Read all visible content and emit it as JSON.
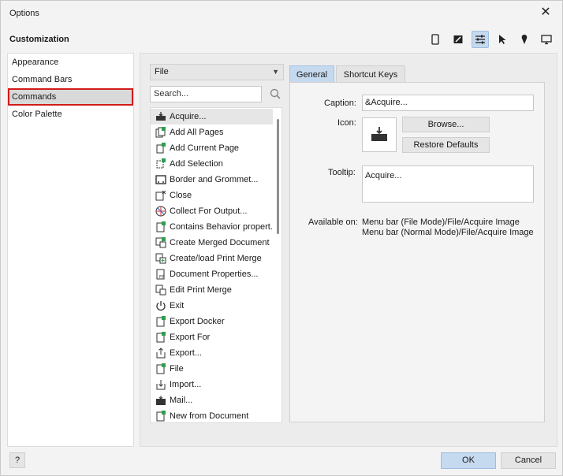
{
  "window": {
    "title": "Options"
  },
  "section_title": "Customization",
  "toolbar_icons": [
    {
      "name": "document-icon"
    },
    {
      "name": "image-edit-icon"
    },
    {
      "name": "sliders-icon",
      "active": true
    },
    {
      "name": "pointer-icon"
    },
    {
      "name": "pin-icon"
    },
    {
      "name": "monitor-icon"
    }
  ],
  "nav": [
    {
      "label": "Appearance"
    },
    {
      "label": "Command Bars"
    },
    {
      "label": "Commands",
      "selected": true
    },
    {
      "label": "Color Palette"
    }
  ],
  "category_select": {
    "value": "File"
  },
  "search": {
    "placeholder": "Search..."
  },
  "commands": [
    {
      "label": "Acquire...",
      "icon": "scanner-icon",
      "selected": true
    },
    {
      "label": "Add All Pages",
      "icon": "pages-icon"
    },
    {
      "label": "Add Current Page",
      "icon": "page-add-icon"
    },
    {
      "label": "Add Selection",
      "icon": "selection-add-icon"
    },
    {
      "label": "Border and Grommet...",
      "icon": "border-grommet-icon"
    },
    {
      "label": "Close",
      "icon": "close-doc-icon"
    },
    {
      "label": "Collect For Output...",
      "icon": "collect-icon"
    },
    {
      "label": "Contains Behavior propert...",
      "icon": "behavior-icon"
    },
    {
      "label": "Create Merged Document",
      "icon": "merge-doc-icon"
    },
    {
      "label": "Create/load Print Merge",
      "icon": "print-merge-icon"
    },
    {
      "label": "Document Properties...",
      "icon": "doc-properties-icon"
    },
    {
      "label": "Edit Print Merge",
      "icon": "edit-merge-icon"
    },
    {
      "label": "Exit",
      "icon": "power-icon"
    },
    {
      "label": "Export Docker",
      "icon": "export-docker-icon"
    },
    {
      "label": "Export For",
      "icon": "export-for-icon"
    },
    {
      "label": "Export...",
      "icon": "export-icon"
    },
    {
      "label": "File",
      "icon": "file-icon"
    },
    {
      "label": "Import...",
      "icon": "import-icon"
    },
    {
      "label": "Mail...",
      "icon": "mail-icon"
    },
    {
      "label": "New from Document",
      "icon": "new-doc-icon"
    }
  ],
  "tabs": [
    {
      "label": "General",
      "active": true
    },
    {
      "label": "Shortcut Keys"
    }
  ],
  "general": {
    "caption_label": "Caption:",
    "caption_value": "&Acquire...",
    "icon_label": "Icon:",
    "browse_label": "Browse...",
    "restore_label": "Restore Defaults",
    "tooltip_label": "Tooltip:",
    "tooltip_value": "Acquire...",
    "available_label": "Available on:",
    "available_values": [
      "Menu bar (File Mode)/File/Acquire Image",
      "Menu bar (Normal Mode)/File/Acquire Image"
    ]
  },
  "footer": {
    "help_label": "?",
    "ok_label": "OK",
    "cancel_label": "Cancel"
  },
  "colors": {
    "accent": "#c5d9ef",
    "selection_outline": "#d21a1a"
  }
}
